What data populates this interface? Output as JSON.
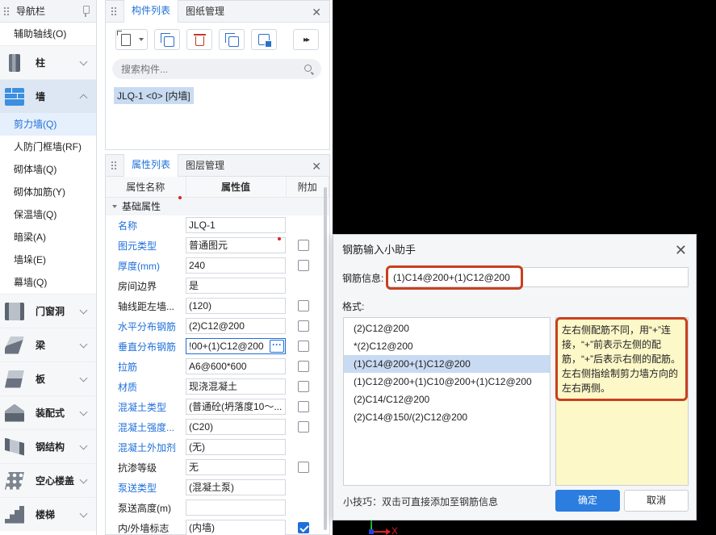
{
  "nav": {
    "title": "导航栏",
    "items": [
      {
        "label": "辅助轴线(O)",
        "active": false
      }
    ],
    "categories": [
      {
        "label": "柱",
        "icon": "pillar-icon",
        "open": false
      },
      {
        "label": "墙",
        "icon": "wall-icon",
        "open": true,
        "children": [
          {
            "label": "剪力墙(Q)",
            "active": true
          },
          {
            "label": "人防门框墙(RF)",
            "active": false
          },
          {
            "label": "砌体墙(Q)",
            "active": false
          },
          {
            "label": "砌体加筋(Y)",
            "active": false
          },
          {
            "label": "保温墙(Q)",
            "active": false
          },
          {
            "label": "暗梁(A)",
            "active": false
          },
          {
            "label": "墙垛(E)",
            "active": false
          },
          {
            "label": "幕墙(Q)",
            "active": false
          }
        ]
      },
      {
        "label": "门窗洞",
        "icon": "door-window-icon",
        "open": false
      },
      {
        "label": "梁",
        "icon": "beam-icon",
        "open": false
      },
      {
        "label": "板",
        "icon": "slab-icon",
        "open": false
      },
      {
        "label": "装配式",
        "icon": "prefab-icon",
        "open": false
      },
      {
        "label": "钢结构",
        "icon": "steel-icon",
        "open": false
      },
      {
        "label": "空心楼盖",
        "icon": "hollow-slab-icon",
        "open": false
      },
      {
        "label": "楼梯",
        "icon": "stair-icon",
        "open": false
      }
    ]
  },
  "component_panel": {
    "tabs": [
      "构件列表",
      "图纸管理"
    ],
    "active_tab": "构件列表",
    "search_placeholder": "搜索构件...",
    "items": [
      "JLQ-1 <0> [内墙]"
    ]
  },
  "property_panel": {
    "tabs": [
      "属性列表",
      "图层管理"
    ],
    "active_tab": "属性列表",
    "columns": [
      "属性名称",
      "属性值",
      "附加"
    ],
    "group": "基础属性",
    "rows": [
      {
        "name": "名称",
        "value": "JLQ-1",
        "blue": true,
        "checkbox": null
      },
      {
        "name": "图元类型",
        "value": "普通图元",
        "blue": true,
        "checkbox": false
      },
      {
        "name": "厚度(mm)",
        "value": "240",
        "blue": true,
        "checkbox": false
      },
      {
        "name": "房间边界",
        "value": "是",
        "blue": false,
        "checkbox": null
      },
      {
        "name": "轴线距左墙...",
        "value": "(120)",
        "blue": false,
        "checkbox": false
      },
      {
        "name": "水平分布钢筋",
        "value": "(2)C12@200",
        "blue": true,
        "checkbox": false
      },
      {
        "name": "垂直分布钢筋",
        "value": "!00+(1)C12@200",
        "blue": true,
        "checkbox": false
      },
      {
        "name": "拉筋",
        "value": "A6@600*600",
        "blue": true,
        "checkbox": false
      },
      {
        "name": "材质",
        "value": "现浇混凝土",
        "blue": true,
        "checkbox": false
      },
      {
        "name": "混凝土类型",
        "value": "(普通砼(坍落度10～...",
        "blue": true,
        "checkbox": false
      },
      {
        "name": "混凝土强度...",
        "value": "(C20)",
        "blue": true,
        "checkbox": false
      },
      {
        "name": "混凝土外加剂",
        "value": "(无)",
        "blue": true,
        "checkbox": null
      },
      {
        "name": "抗渗等级",
        "value": "无",
        "blue": false,
        "checkbox": false
      },
      {
        "name": "泵送类型",
        "value": "(混凝土泵)",
        "blue": true,
        "checkbox": null
      },
      {
        "name": "泵送高度(m)",
        "value": "",
        "blue": false,
        "checkbox": null
      },
      {
        "name": "内/外墙标志",
        "value": "(内墙)",
        "blue": false,
        "checkbox": true
      }
    ]
  },
  "dialog": {
    "title": "钢筋输入小助手",
    "rebar_label": "钢筋信息:",
    "rebar_value": "(1)C14@200+(1)C12@200",
    "format_label": "格式:",
    "formats": [
      "(2)C12@200",
      "*(2)C12@200",
      "(1)C14@200+(1)C12@200",
      "(1)C12@200+(1)C10@200+(1)C12@200",
      "(2)C14/C12@200",
      "(2)C14@150/(2)C12@200"
    ],
    "selected_format": 2,
    "hint": "左右侧配筋不同，用“+”连接，“+”前表示左侧的配筋，“+”后表示右侧的配筋。左右侧指绘制剪力墙方向的左右两侧。",
    "tip": "小技巧：双击可直接添加至钢筋信息",
    "ok_label": "确定",
    "cancel_label": "取消"
  },
  "canvas": {
    "axis_x_label": "X"
  },
  "colors": {
    "accent": "#1e6fd9",
    "highlight": "#c8401f",
    "hint_bg": "#fdf8c8"
  }
}
